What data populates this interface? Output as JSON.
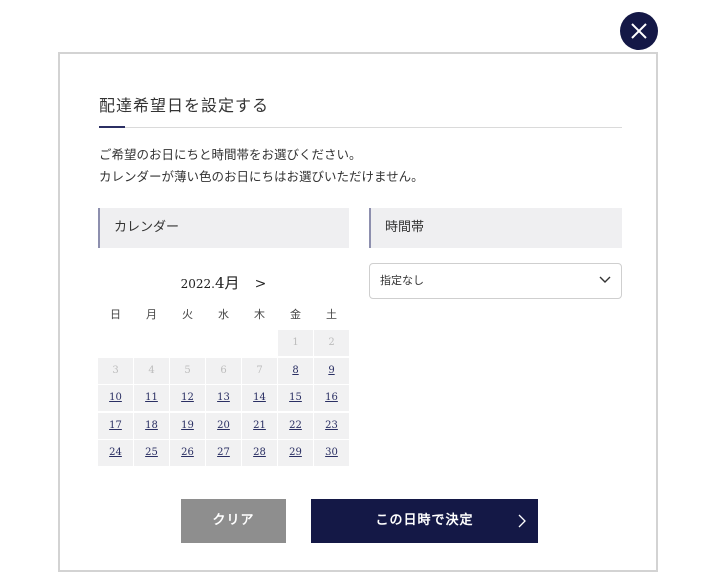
{
  "dialog": {
    "title": "配達希望日を設定する",
    "description": [
      "ご希望のお日にちと時間帯をお選びください。",
      "カレンダーが薄い色のお日にちはお選びいただけません。"
    ],
    "close_icon": "close-icon"
  },
  "calendar": {
    "header": "カレンダー",
    "year": "2022.",
    "month": "4月",
    "next_label": ">",
    "weekdays": [
      "日",
      "月",
      "火",
      "水",
      "木",
      "金",
      "土"
    ],
    "weeks": [
      [
        null,
        null,
        null,
        null,
        null,
        {
          "d": "1",
          "s": "disabled"
        },
        {
          "d": "2",
          "s": "disabled"
        }
      ],
      [
        {
          "d": "3",
          "s": "disabled"
        },
        {
          "d": "4",
          "s": "disabled"
        },
        {
          "d": "5",
          "s": "disabled"
        },
        {
          "d": "6",
          "s": "disabled"
        },
        {
          "d": "7",
          "s": "disabled"
        },
        {
          "d": "8",
          "s": "available"
        },
        {
          "d": "9",
          "s": "available"
        }
      ],
      [
        {
          "d": "10",
          "s": "available"
        },
        {
          "d": "11",
          "s": "available"
        },
        {
          "d": "12",
          "s": "available"
        },
        {
          "d": "13",
          "s": "available"
        },
        {
          "d": "14",
          "s": "available"
        },
        {
          "d": "15",
          "s": "available"
        },
        {
          "d": "16",
          "s": "available"
        }
      ],
      [
        {
          "d": "17",
          "s": "available"
        },
        {
          "d": "18",
          "s": "available"
        },
        {
          "d": "19",
          "s": "available"
        },
        {
          "d": "20",
          "s": "available"
        },
        {
          "d": "21",
          "s": "available"
        },
        {
          "d": "22",
          "s": "available"
        },
        {
          "d": "23",
          "s": "available"
        }
      ],
      [
        {
          "d": "24",
          "s": "available"
        },
        {
          "d": "25",
          "s": "available"
        },
        {
          "d": "26",
          "s": "available"
        },
        {
          "d": "27",
          "s": "available"
        },
        {
          "d": "28",
          "s": "available"
        },
        {
          "d": "29",
          "s": "available"
        },
        {
          "d": "30",
          "s": "available"
        }
      ]
    ]
  },
  "time_slot": {
    "header": "時間帯",
    "selected": "指定なし",
    "chevron_icon": "chevron-down-icon"
  },
  "buttons": {
    "clear_label": "クリア",
    "confirm_label": "この日時で決定",
    "confirm_icon": "chevron-right-icon"
  },
  "colors": {
    "primary": "#141846",
    "clear_button": "#8e8e8e",
    "accent_border": "#8d8fae",
    "cell_bg": "#f1f1f2"
  }
}
